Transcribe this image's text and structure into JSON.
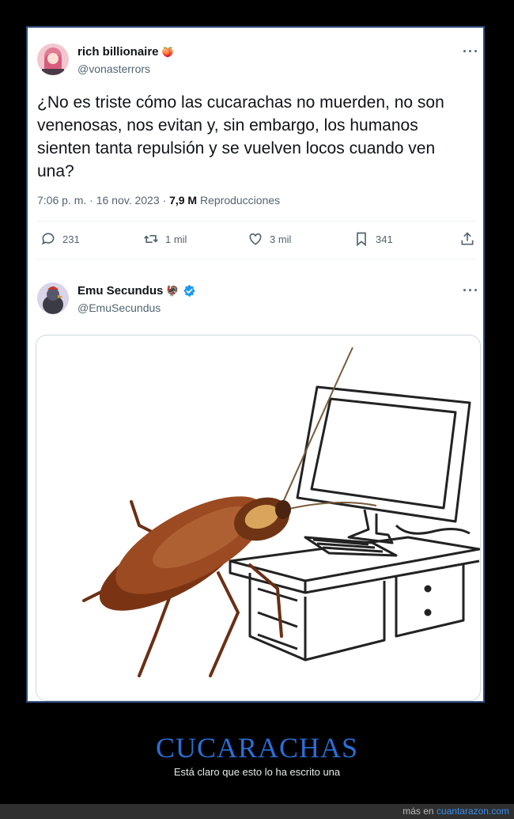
{
  "tweet1": {
    "name": "rich billionaire",
    "name_emoji": "🍑",
    "handle": "@vonasterrors",
    "text": "¿No es triste cómo las cucarachas no muerden, no son venenosas, nos evitan y, sin embargo, los humanos sienten tanta repulsión y se vuelven locos cuando ven una?",
    "time": "7:06 p. m. · 16 nov. 2023 ·",
    "views": "7,9 M",
    "views_label": "Reproducciones",
    "replies": "231",
    "retweets": "1 mil",
    "likes": "3 mil",
    "bookmarks": "341"
  },
  "tweet2": {
    "name": "Emu Secundus",
    "name_emoji": "🦃",
    "handle": "@EmuSecundus",
    "verified_color": "#1d9bf0"
  },
  "caption": {
    "title": "CUCARACHAS",
    "subtitle": "Está claro que esto lo ha escrito una"
  },
  "footer": {
    "prefix": "más en",
    "site": "cuantarazon.com"
  },
  "icons": [
    "more-icon",
    "reply-icon",
    "retweet-icon",
    "like-icon",
    "bookmark-icon",
    "share-icon",
    "verified-icon"
  ],
  "colors": {
    "accent": "#2a6fd6",
    "verified": "#1d9bf0",
    "frame": "#2f4d7a"
  }
}
